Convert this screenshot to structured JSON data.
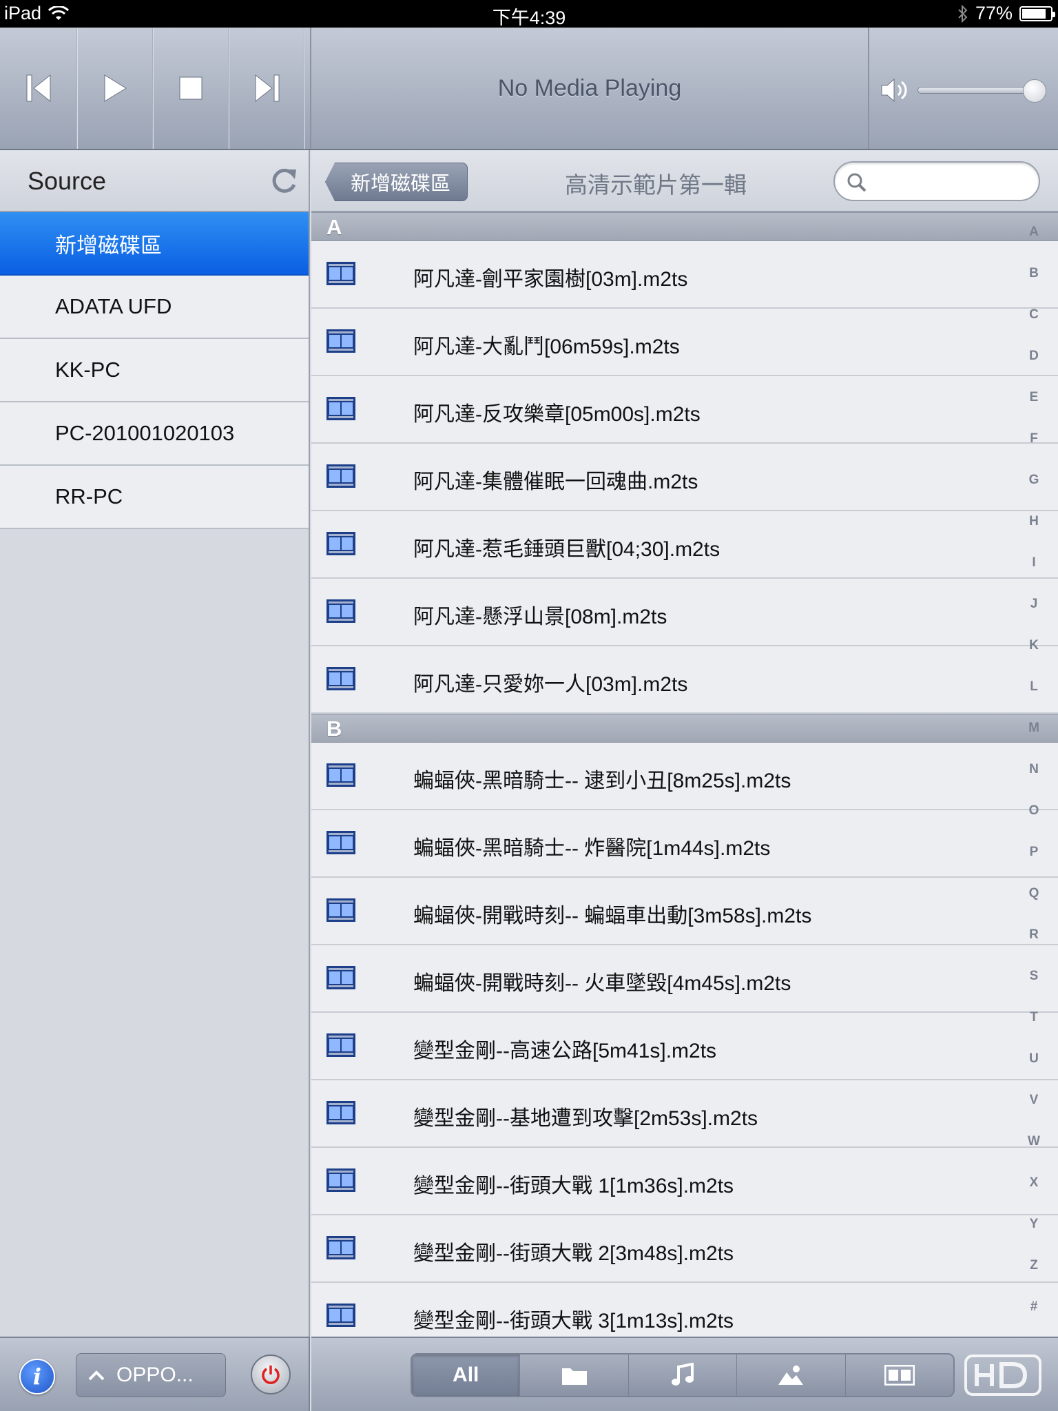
{
  "status_bar": {
    "device": "iPad",
    "time": "下午4:39",
    "battery_text": "77%",
    "battery_level": 0.77
  },
  "transport": {
    "now_playing": "No Media Playing",
    "volume_level": 0.95
  },
  "sidebar": {
    "title": "Source",
    "items": [
      {
        "label": "新增磁碟區",
        "selected": true
      },
      {
        "label": "ADATA UFD",
        "selected": false
      },
      {
        "label": "KK-PC",
        "selected": false
      },
      {
        "label": "PC-201001020103",
        "selected": false
      },
      {
        "label": "RR-PC",
        "selected": false
      }
    ]
  },
  "navbar": {
    "back_label": "新增磁碟區",
    "folder_title": "高清示範片第一輯",
    "search_placeholder": ""
  },
  "sections": [
    {
      "letter": "A",
      "files": [
        "阿凡達-劊平家園樹[03m].m2ts",
        "阿凡達-大亂鬥[06m59s].m2ts",
        "阿凡達-反攻樂章[05m00s].m2ts",
        "阿凡達-集體催眠一回魂曲.m2ts",
        "阿凡達-惹毛錘頭巨獸[04;30].m2ts",
        "阿凡達-懸浮山景[08m].m2ts",
        "阿凡達-只愛妳一人[03m].m2ts"
      ]
    },
    {
      "letter": "B",
      "files": [
        "蝙蝠俠-黑暗騎士-- 逮到小丑[8m25s].m2ts",
        "蝙蝠俠-黑暗騎士-- 炸醫院[1m44s].m2ts",
        "蝙蝠俠-開戰時刻-- 蝙蝠車出動[3m58s].m2ts",
        "蝙蝠俠-開戰時刻-- 火車墜毀[4m45s].m2ts",
        "變型金剛--高速公路[5m41s].m2ts",
        "變型金剛--基地遭到攻擊[2m53s].m2ts",
        "變型金剛--街頭大戰 1[1m36s].m2ts",
        "變型金剛--街頭大戰 2[3m48s].m2ts",
        "變型金剛--街頭大戰 3[1m13s].m2ts"
      ]
    }
  ],
  "index_letters": [
    "A",
    "B",
    "C",
    "D",
    "E",
    "F",
    "G",
    "H",
    "I",
    "J",
    "K",
    "L",
    "M",
    "N",
    "O",
    "P",
    "Q",
    "R",
    "S",
    "T",
    "U",
    "V",
    "W",
    "X",
    "Y",
    "Z",
    "#"
  ],
  "bottom_left": {
    "device_label": "OPPO..."
  },
  "filter_tabs": [
    {
      "label": "All",
      "icon": "text",
      "active": true
    },
    {
      "label": "",
      "icon": "folder-icon",
      "active": false
    },
    {
      "label": "",
      "icon": "music-note-icon",
      "active": false
    },
    {
      "label": "",
      "icon": "photo-icon",
      "active": false
    },
    {
      "label": "",
      "icon": "film-icon",
      "active": false
    }
  ],
  "colors": {
    "selected_blue": "#0a5fe3",
    "power_red": "#e0201e"
  }
}
